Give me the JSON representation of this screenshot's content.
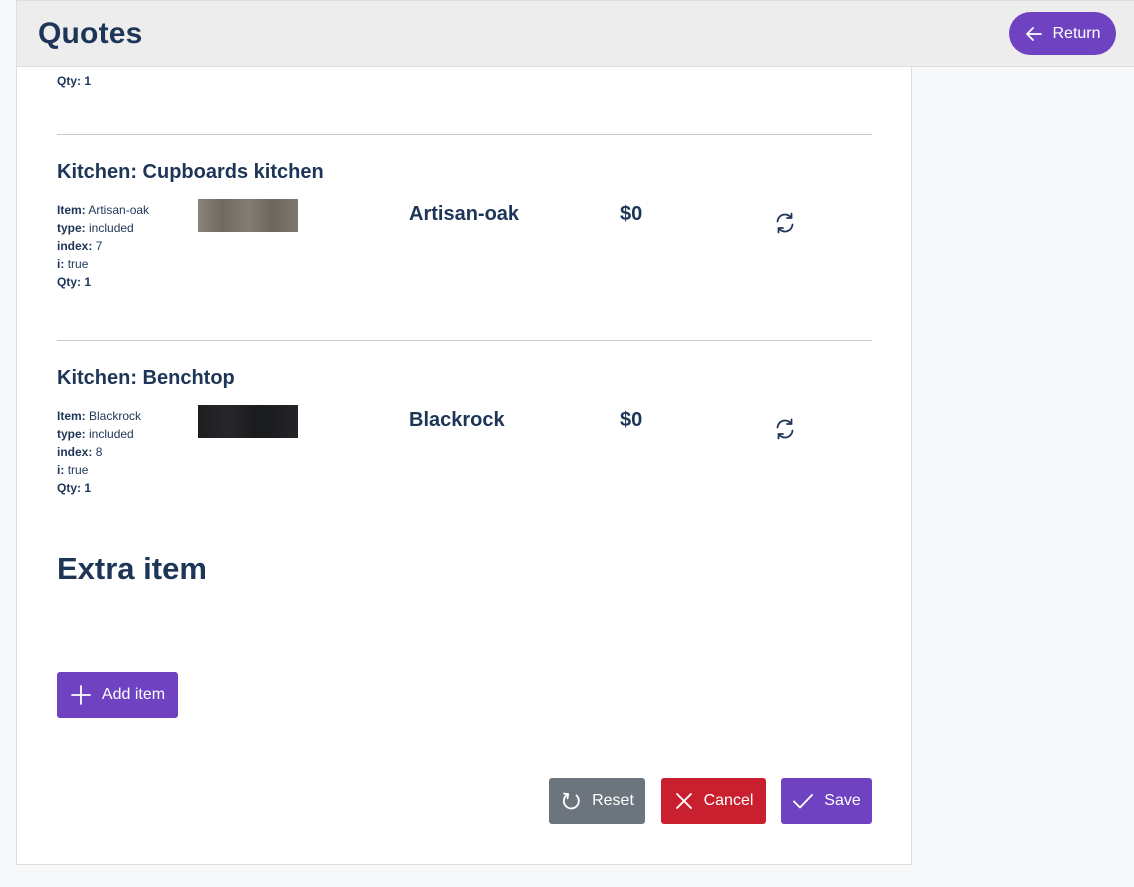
{
  "header": {
    "title": "Quotes",
    "return_label": "Return"
  },
  "top_partial": {
    "qty_label": "Qty:",
    "qty_value": "1"
  },
  "sections": [
    {
      "title": "Kitchen: Cupboards kitchen",
      "item_label": "Item:",
      "item_value": "Artisan-oak",
      "type_label": "type:",
      "type_value": "included",
      "index_label": "index:",
      "index_value": "7",
      "i_label": "i:",
      "i_value": "true",
      "qty_label": "Qty:",
      "qty_value": "1",
      "name": "Artisan-oak",
      "price": "$0",
      "swatch_color": "#7d776e"
    },
    {
      "title": "Kitchen: Benchtop",
      "item_label": "Item:",
      "item_value": "Blackrock",
      "type_label": "type:",
      "type_value": "included",
      "index_label": "index:",
      "index_value": "8",
      "i_label": "i:",
      "i_value": "true",
      "qty_label": "Qty:",
      "qty_value": "1",
      "name": "Blackrock",
      "price": "$0",
      "swatch_color": "#202124"
    }
  ],
  "extra": {
    "title": "Extra item",
    "add_label": "Add item"
  },
  "actions": {
    "reset_label": "Reset",
    "cancel_label": "Cancel",
    "save_label": "Save"
  },
  "colors": {
    "primary": "#6f42c1",
    "danger": "#c8202f",
    "secondary": "#6c757d",
    "heading": "#1d3557"
  },
  "icons": {
    "return": "arrow-left-icon",
    "refresh": "refresh-icon",
    "add": "plus-icon",
    "reset": "rotate-icon",
    "cancel": "x-icon",
    "save": "check-icon"
  }
}
